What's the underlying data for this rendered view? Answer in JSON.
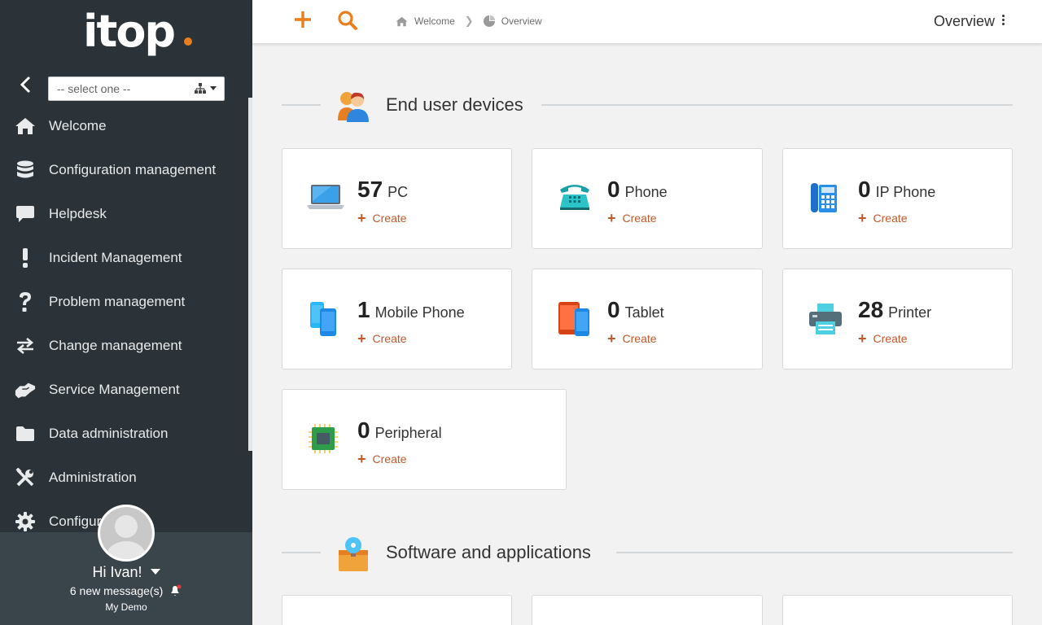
{
  "brand": {
    "logo_text": "itop",
    "accent": "#ea7d1e",
    "sidebar_bg": "#2b3338"
  },
  "sidebar": {
    "org_select": {
      "value": "-- select one --"
    },
    "items": [
      {
        "label": "Welcome",
        "icon": "home-icon"
      },
      {
        "label": "Configuration management",
        "icon": "database-icon"
      },
      {
        "label": "Helpdesk",
        "icon": "comment-icon"
      },
      {
        "label": "Incident Management",
        "icon": "exclamation-icon"
      },
      {
        "label": "Problem management",
        "icon": "question-icon"
      },
      {
        "label": "Change management",
        "icon": "exchange-icon"
      },
      {
        "label": "Service Management",
        "icon": "handshake-icon"
      },
      {
        "label": "Data administration",
        "icon": "folder-icon"
      },
      {
        "label": "Administration",
        "icon": "tools-icon"
      },
      {
        "label": "Configur",
        "icon": "cog-icon"
      }
    ],
    "user": {
      "greeting": "Hi Ivan!",
      "messages": "6 new message(s)",
      "org": "My Demo"
    }
  },
  "topbar": {
    "breadcrumbs": [
      "Welcome",
      "Overview"
    ],
    "title": "Overview"
  },
  "sections": [
    {
      "title": "End user devices",
      "icon": "users-icon",
      "cards": [
        {
          "count": "57",
          "label": "PC",
          "create": "Create",
          "icon": "laptop-icon"
        },
        {
          "count": "0",
          "label": "Phone",
          "create": "Create",
          "icon": "desk-phone-icon"
        },
        {
          "count": "0",
          "label": "IP Phone",
          "create": "Create",
          "icon": "ip-phone-icon"
        },
        {
          "count": "1",
          "label": "Mobile Phone",
          "create": "Create",
          "icon": "mobile-phone-icon"
        },
        {
          "count": "0",
          "label": "Tablet",
          "create": "Create",
          "icon": "tablet-icon"
        },
        {
          "count": "28",
          "label": "Printer",
          "create": "Create",
          "icon": "printer-icon"
        },
        {
          "count": "0",
          "label": "Peripheral",
          "create": "Create",
          "icon": "chip-icon"
        }
      ]
    },
    {
      "title": "Software and applications",
      "icon": "software-box-icon"
    }
  ]
}
